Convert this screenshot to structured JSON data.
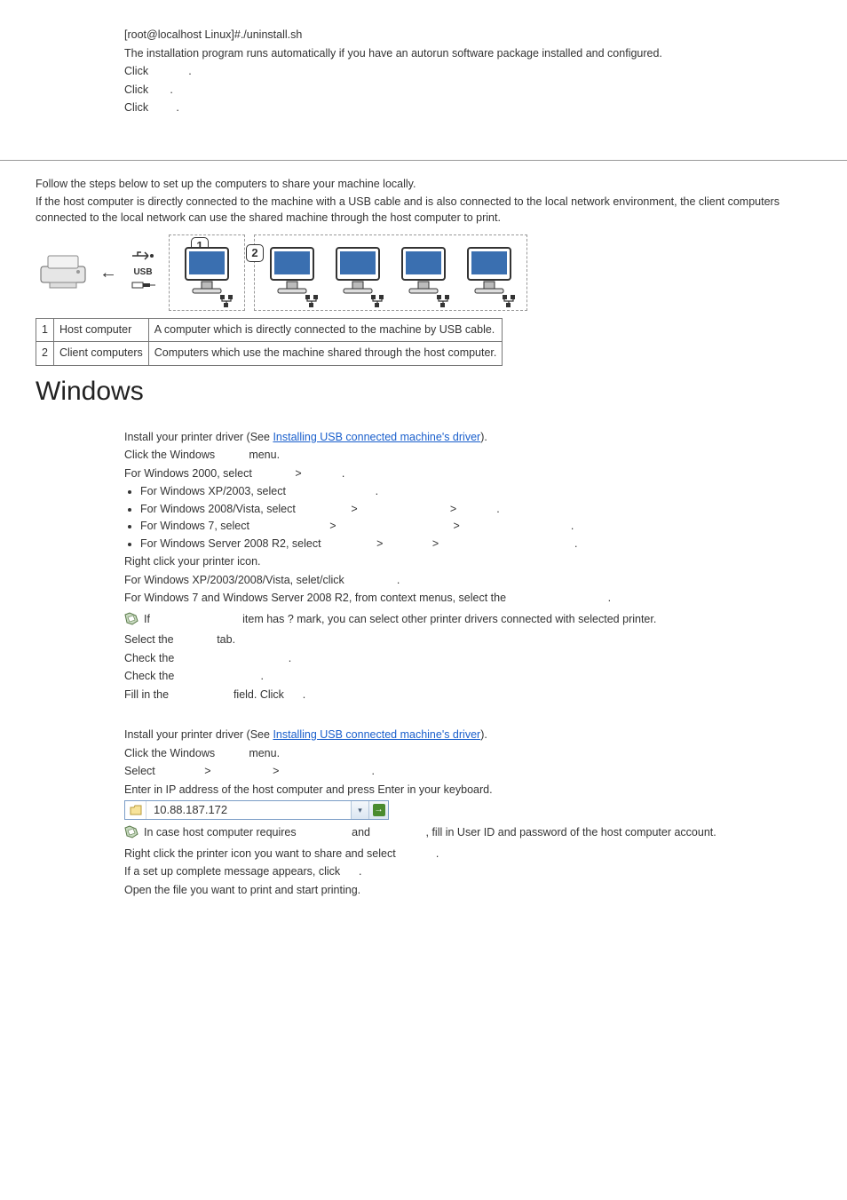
{
  "top": {
    "line1": "[root@localhost Linux]#./uninstall.sh",
    "line2": "The installation program runs automatically if you have an autorun software package installed and configured.",
    "click1": "Click",
    "click2": "Click",
    "click3": "Click",
    "dot": "."
  },
  "intro": {
    "line1": "Follow the steps below to set up the computers to share your machine locally.",
    "line2": "If the host computer is directly connected to the machine with a USB cable and is also connected to the local network environment, the client computers connected to the local network can use the shared machine through the host computer to print."
  },
  "diagram": {
    "usb_label": "USB",
    "badge1": "1",
    "badge2": "2"
  },
  "table": {
    "rows": [
      {
        "num": "1",
        "term": "Host computer",
        "desc": "A computer which is directly connected to the machine by USB cable."
      },
      {
        "num": "2",
        "term": "Client computers",
        "desc": "Computers which use the machine shared through the host computer."
      }
    ]
  },
  "heading_windows": "Windows",
  "setup1": {
    "l1_a": "Install your printer driver (See ",
    "l1_link": "Installing USB connected machine's driver",
    "l1_b": ").",
    "l2": "Click the Windows           menu.",
    "l3": "For Windows 2000, select              >             .",
    "b1": "For Windows XP/2003, select                             .",
    "b2": "For Windows 2008/Vista, select                  >                              >             .",
    "b3": "For Windows 7, select                          >                                      >                                    .",
    "b4": "For Windows Server 2008 R2, select                  >                >                                            .",
    "l4": "Right click your printer icon.",
    "l5": "For Windows XP/2003/2008/Vista, selet/click                 .",
    "l6": "For Windows 7 and Windows Server 2008 R2, from context menus, select the                                 .",
    "note1a": "If                              item has ? mark, you can select other printer drivers connected with selected printer.",
    "l7": "Select the              tab.",
    "l8": "Check the                                     .",
    "l9": "Check the                            .",
    "l10": "Fill in the                     field. Click      ."
  },
  "setup2": {
    "l1_a": "Install your printer driver (See ",
    "l1_link": "Installing USB connected machine's driver",
    "l1_b": ").",
    "l2": "Click the Windows           menu.",
    "l3": "Select                >                    >                              .",
    "l4": "Enter in IP address of the host computer and press Enter in your keyboard.",
    "addr": "10.88.187.172",
    "note2": "In case host computer requires                  and                  , fill in User ID and password of the host computer account.",
    "l5": "Right click the printer icon you want to share and select             .",
    "l6": "If a set up complete message appears, click      .",
    "l7": "Open the file you want to print and start printing."
  }
}
